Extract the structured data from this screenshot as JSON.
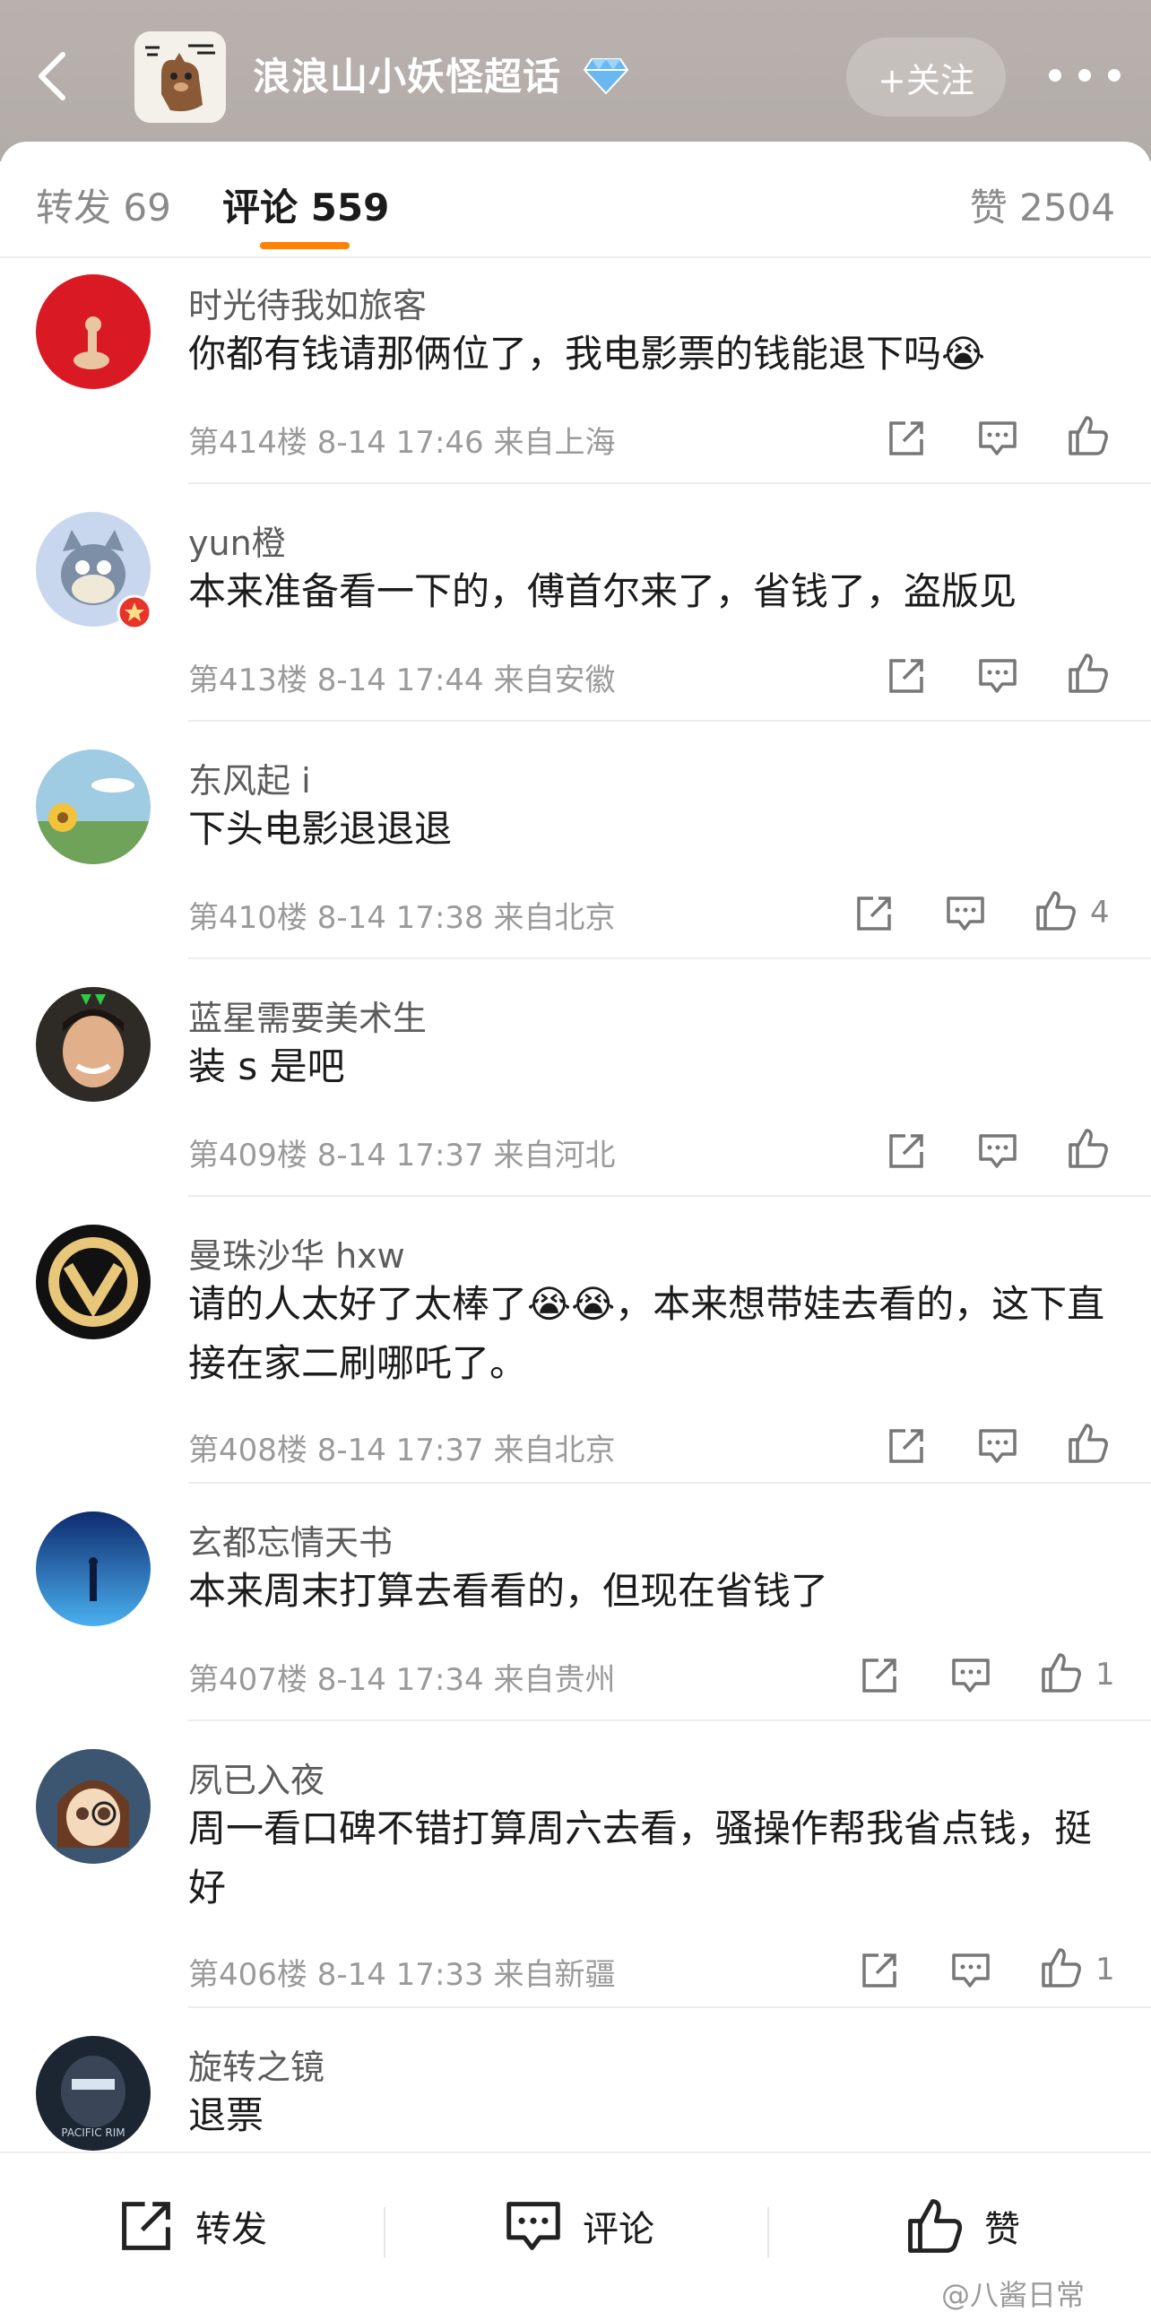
{
  "header": {
    "topic_title": "浪浪山小妖怪超话",
    "follow_label": "+关注",
    "logo_text": "浪浪山小妖怪"
  },
  "tabs": {
    "repost": "转发 69",
    "comment": "评论 559",
    "like": "赞 2504"
  },
  "comments": [
    {
      "name": "时光待我如旅客",
      "text": "你都有钱请那俩位了，我电影票的钱能退下吗😭",
      "meta": "第414楼 8-14 17:46 来自上海",
      "likes": ""
    },
    {
      "name": "yun橙",
      "text": "本来准备看一下的，傅首尔来了，省钱了，盗版见",
      "meta": "第413楼 8-14 17:44 来自安徽",
      "likes": ""
    },
    {
      "name": "东风起 i",
      "text": "下头电影退退退",
      "meta": "第410楼 8-14 17:38 来自北京",
      "likes": "4"
    },
    {
      "name": "蓝星需要美术生",
      "text": "装 s 是吧",
      "meta": "第409楼 8-14 17:37 来自河北",
      "likes": ""
    },
    {
      "name": "曼珠沙华 hxw",
      "text": "请的人太好了太棒了😭😭，本来想带娃去看的，这下直接在家二刷哪吒了。",
      "meta": "第408楼 8-14 17:37 来自北京",
      "likes": ""
    },
    {
      "name": "玄都忘情天书",
      "text": "本来周末打算去看看的，但现在省钱了",
      "meta": "第407楼 8-14 17:34 来自贵州",
      "likes": "1"
    },
    {
      "name": "夙已入夜",
      "text": "周一看口碑不错打算周六去看，骚操作帮我省点钱，挺好",
      "meta": "第406楼 8-14 17:33 来自新疆",
      "likes": "1"
    },
    {
      "name": "旋转之镜",
      "text": "退票",
      "meta": "",
      "likes": ""
    }
  ],
  "bottom": {
    "repost": "转发",
    "comment": "评论",
    "like": "赞"
  },
  "watermark": "@八酱日常",
  "colors": {
    "accent": "#ff8200",
    "header_bg": "#b5afab"
  }
}
